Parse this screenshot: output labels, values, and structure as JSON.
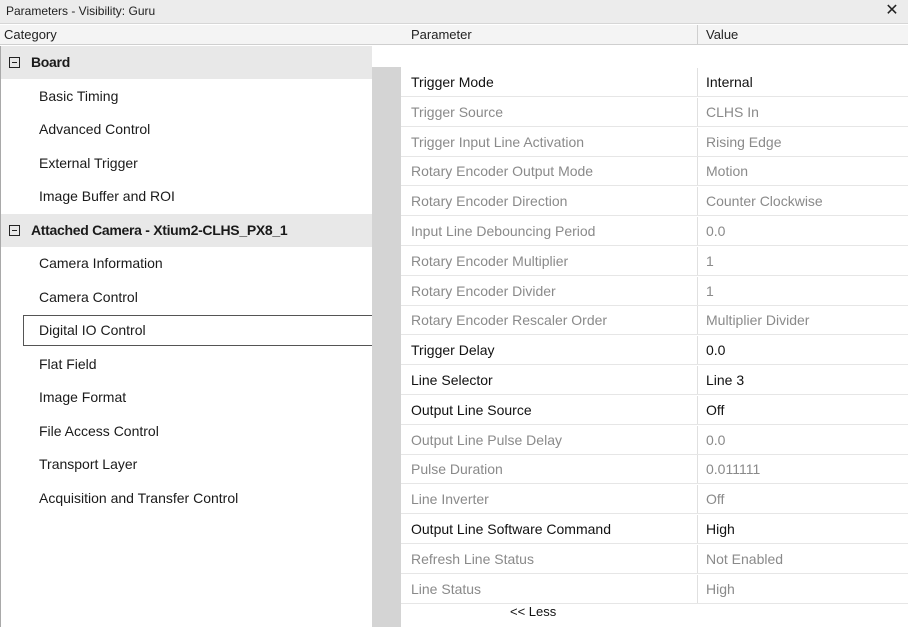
{
  "window": {
    "title": "Parameters - Visibility: Guru",
    "close_label": "✕"
  },
  "headers": {
    "category": "Category",
    "parameter": "Parameter",
    "value": "Value"
  },
  "categories": [
    {
      "label": "Board",
      "kind": "group"
    },
    {
      "label": "Basic Timing",
      "kind": "item"
    },
    {
      "label": "Advanced Control",
      "kind": "item"
    },
    {
      "label": "External Trigger",
      "kind": "item"
    },
    {
      "label": "Image Buffer and ROI",
      "kind": "item"
    },
    {
      "label": "Attached Camera - Xtium2-CLHS_PX8_1",
      "kind": "group"
    },
    {
      "label": "Camera Information",
      "kind": "item"
    },
    {
      "label": "Camera Control",
      "kind": "item"
    },
    {
      "label": "Digital IO Control",
      "kind": "item",
      "selected": true
    },
    {
      "label": "Flat Field",
      "kind": "item"
    },
    {
      "label": "Image Format",
      "kind": "item"
    },
    {
      "label": "File Access Control",
      "kind": "item"
    },
    {
      "label": "Transport Layer",
      "kind": "item"
    },
    {
      "label": "Acquisition and Transfer Control",
      "kind": "item"
    }
  ],
  "parameters": [
    {
      "name": "Trigger Mode",
      "value": "Internal",
      "enabled": true
    },
    {
      "name": "Trigger Source",
      "value": "CLHS In",
      "enabled": false
    },
    {
      "name": "Trigger Input Line Activation",
      "value": "Rising Edge",
      "enabled": false
    },
    {
      "name": "Rotary Encoder Output Mode",
      "value": "Motion",
      "enabled": false
    },
    {
      "name": "Rotary Encoder Direction",
      "value": "Counter Clockwise",
      "enabled": false
    },
    {
      "name": "Input Line Debouncing Period",
      "value": "0.0",
      "enabled": false
    },
    {
      "name": "Rotary Encoder Multiplier",
      "value": "1",
      "enabled": false
    },
    {
      "name": "Rotary Encoder Divider",
      "value": "1",
      "enabled": false
    },
    {
      "name": "Rotary Encoder Rescaler Order",
      "value": "Multiplier Divider",
      "enabled": false
    },
    {
      "name": "Trigger Delay",
      "value": "0.0",
      "enabled": true
    },
    {
      "name": "Line Selector",
      "value": "Line 3",
      "enabled": true
    },
    {
      "name": "Output Line Source",
      "value": "Off",
      "enabled": true
    },
    {
      "name": "Output Line Pulse Delay",
      "value": "0.0",
      "enabled": false
    },
    {
      "name": "Pulse Duration",
      "value": "0.011111",
      "enabled": false
    },
    {
      "name": "Line Inverter",
      "value": "Off",
      "enabled": false
    },
    {
      "name": "Output Line Software Command",
      "value": "High",
      "enabled": true
    },
    {
      "name": "Refresh Line Status",
      "value": "Not Enabled",
      "enabled": false
    },
    {
      "name": "Line Status",
      "value": "High",
      "enabled": false
    }
  ],
  "less_label": "<< Less",
  "colors": {
    "enabled_text": "#111111",
    "disabled_text": "#8a8a8a",
    "group_bg": "#e8e8e8",
    "scrollbar": "#d4d4d4"
  }
}
